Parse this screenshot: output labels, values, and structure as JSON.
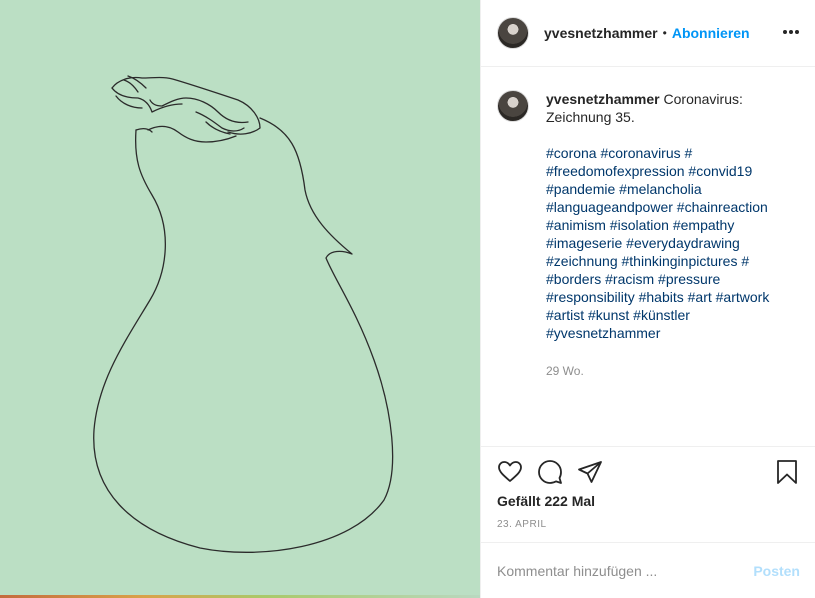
{
  "post": {
    "image": {
      "background_color": "#bbdfc4",
      "line_color": "#2b2b2b",
      "subject": "line-drawing of a pear-shaped figure with a hand on top"
    }
  },
  "header": {
    "username": "yvesnetzhammer",
    "separator": "•",
    "follow_label": "Abonnieren",
    "more_icon": "more-options-icon"
  },
  "caption": {
    "username": "yvesnetzhammer",
    "text": "Coronavirus: Zeichnung 35.",
    "hashtags": [
      "#corona #coronavirus #",
      "#freedomofexpression #convid19",
      "#pandemie #melancholia",
      "#languageandpower #chainreaction",
      "#animism #isolation #empathy",
      "#imageserie #everydaydrawing",
      "#zeichnung #thinkinginpictures #",
      "#borders #racism #pressure",
      "#responsibility #habits #art #artwork",
      "#artist #kunst #künstler",
      "#yvesnetzhammer"
    ],
    "time": "29 Wo."
  },
  "actions": {
    "likes": "Gefällt 222 Mal",
    "date": "23. APRIL"
  },
  "comment": {
    "placeholder": "Kommentar hinzufügen ...",
    "post_label": "Posten"
  },
  "colors": {
    "accent": "#0095f6",
    "hashtag": "#00376b",
    "muted": "#8e8e8e",
    "post_disabled": "#b2dffc"
  }
}
